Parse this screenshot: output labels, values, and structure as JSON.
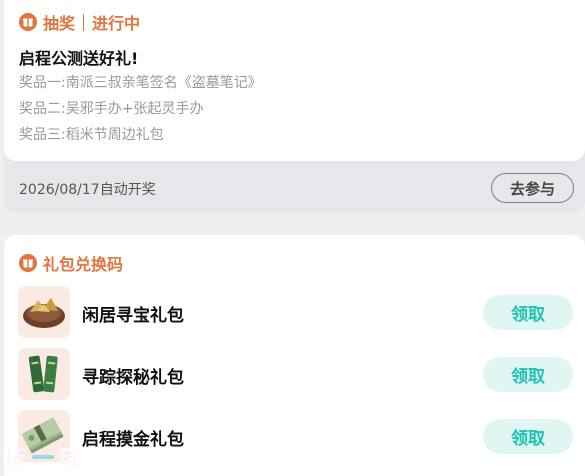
{
  "lottery": {
    "section_label": "抽奖",
    "status": "进行中",
    "title": "启程公测送好礼!",
    "prizes": [
      {
        "label": "奖品一:",
        "text": "南派三叔亲笔签名《盗墓笔记》"
      },
      {
        "label": "奖品二:",
        "text": "吴邪手办+张起灵手办"
      },
      {
        "label": "奖品三:",
        "text": "稻米节周边礼包"
      }
    ],
    "draw_date": "2026/08/17自动开奖",
    "join_label": "去参与"
  },
  "gift_codes": {
    "section_label": "礼包兑换码",
    "items": [
      {
        "name": "闲居寻宝礼包",
        "button": "领取",
        "icon": "treasure-pouch-icon"
      },
      {
        "name": "寻踪探秘礼包",
        "button": "领取",
        "icon": "green-scrolls-icon"
      },
      {
        "name": "启程摸金礼包",
        "button": "领取",
        "icon": "banknote-stack-icon"
      }
    ]
  },
  "watermark": "玩一玩",
  "colors": {
    "accent_orange": "#e0753d",
    "claim_text": "#1ec3b3",
    "claim_bg": "#dff6f3"
  }
}
